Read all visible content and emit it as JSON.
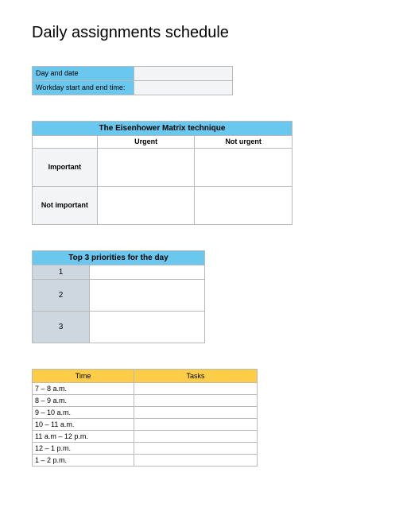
{
  "title": "Daily assignments schedule",
  "basic": {
    "rows": [
      {
        "label": "Day and date",
        "value": ""
      },
      {
        "label": "Workday start and end time:",
        "value": ""
      }
    ]
  },
  "matrix": {
    "title": "The Eisenhower Matrix technique",
    "col1": "Urgent",
    "col2": "Not urgent",
    "row1": "Important",
    "row2": "Not important",
    "q11": "",
    "q12": "",
    "q21": "",
    "q22": ""
  },
  "priorities": {
    "title": "Top 3 priorities for the day",
    "items": [
      {
        "num": "1",
        "value": ""
      },
      {
        "num": "2",
        "value": ""
      },
      {
        "num": "3",
        "value": ""
      }
    ]
  },
  "schedule": {
    "time_header": "Time",
    "tasks_header": "Tasks",
    "rows": [
      {
        "time": "7 – 8 a.m.",
        "task": ""
      },
      {
        "time": "8 – 9 a.m.",
        "task": ""
      },
      {
        "time": "9 – 10 a.m.",
        "task": ""
      },
      {
        "time": "10 – 11 a.m.",
        "task": ""
      },
      {
        "time": "11 a.m – 12 p.m.",
        "task": ""
      },
      {
        "time": "12 – 1 p.m.",
        "task": ""
      },
      {
        "time": "1 – 2 p.m.",
        "task": ""
      }
    ]
  },
  "chart_data": {
    "type": "table",
    "title": "Daily assignments schedule",
    "sections": [
      {
        "name": "basic_info",
        "fields": [
          "Day and date",
          "Workday start and end time:"
        ]
      },
      {
        "name": "eisenhower_matrix",
        "title": "The Eisenhower Matrix technique",
        "columns": [
          "Urgent",
          "Not urgent"
        ],
        "rows": [
          "Important",
          "Not important"
        ]
      },
      {
        "name": "top_priorities",
        "title": "Top 3 priorities for the day",
        "count": 3
      },
      {
        "name": "hourly_schedule",
        "columns": [
          "Time",
          "Tasks"
        ],
        "time_slots": [
          "7 – 8 a.m.",
          "8 – 9 a.m.",
          "9 – 10 a.m.",
          "10 – 11 a.m.",
          "11 a.m – 12 p.m.",
          "12 – 1 p.m.",
          "1 – 2 p.m."
        ]
      }
    ]
  }
}
